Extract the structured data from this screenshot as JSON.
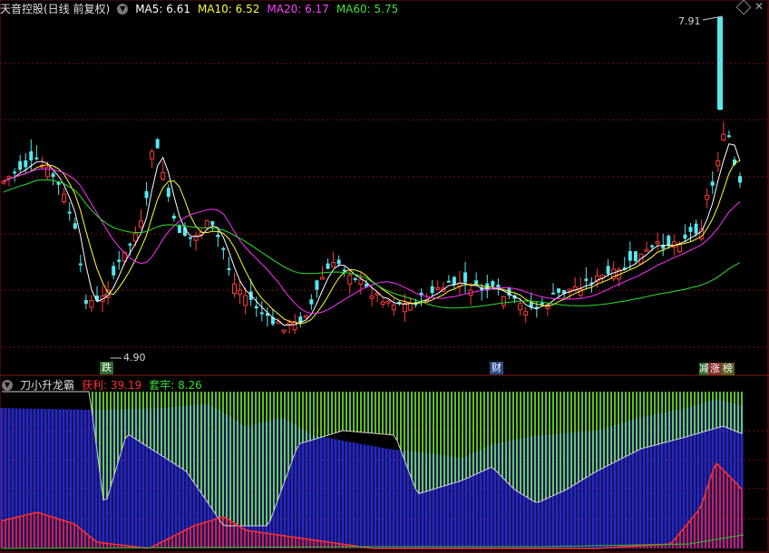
{
  "main_header": {
    "title": "天音控股(日线 前复权)",
    "ma5": "MA5: 6.61",
    "ma10": "MA10: 6.52",
    "ma20": "MA20: 6.17",
    "ma60": "MA60: 5.75"
  },
  "labels": {
    "high": "7.91",
    "low": "4.90",
    "dash": "-"
  },
  "markers": {
    "m1": "跌",
    "m2": "财",
    "m3": "减",
    "m4": "涨",
    "m5": "榜"
  },
  "indicator_header": {
    "name": "刀小升龙霸",
    "profit": "获利: 39.19",
    "trapped": "套牢: 8.26"
  },
  "colors": {
    "up": "#ff3a3a",
    "down": "#54e8f0",
    "ma5": "#ffffff",
    "ma10": "#ffff30",
    "ma20": "#ff30ff",
    "ma60": "#30e030",
    "grid": "#7a1010",
    "indicator_blue": "#2828c8",
    "indicator_green": "#7cff30",
    "indicator_red": "#ff2020"
  }
}
